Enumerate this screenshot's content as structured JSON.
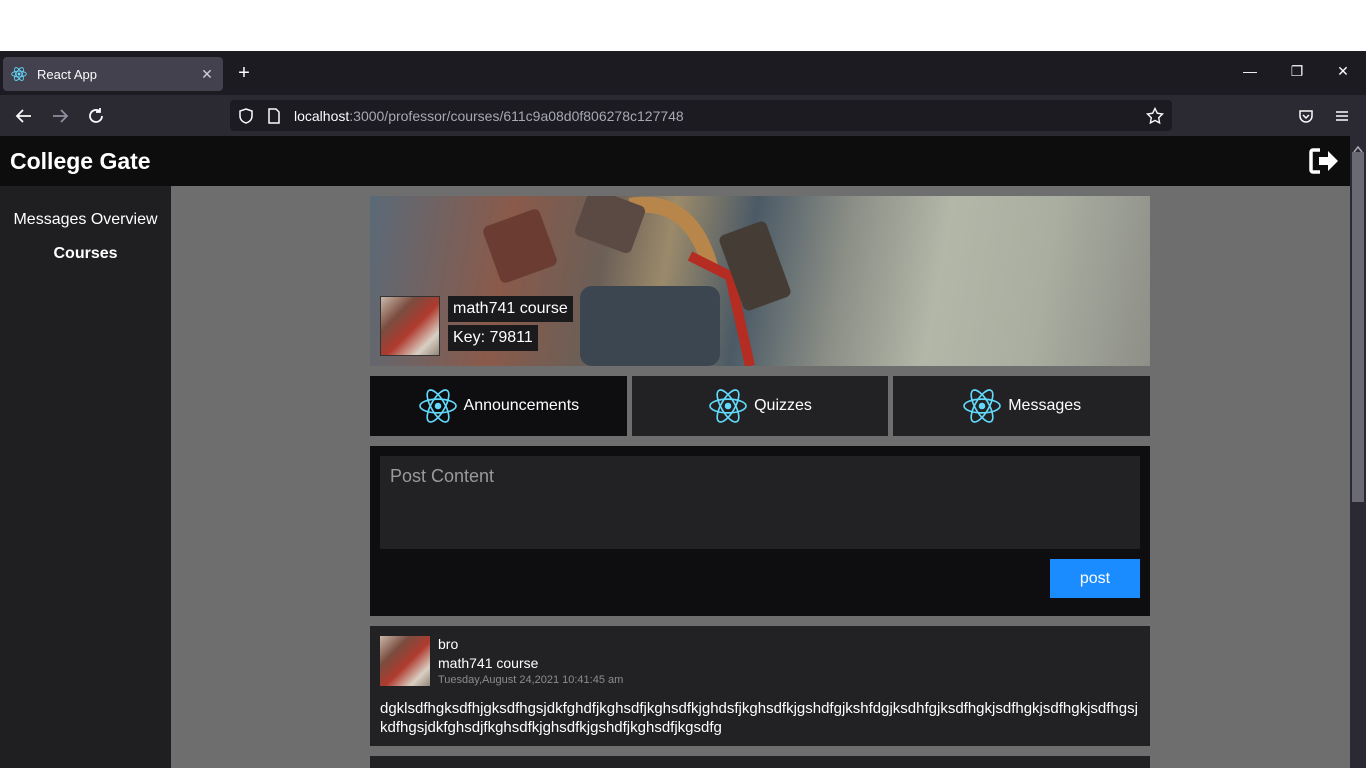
{
  "browser": {
    "tab_title": "React App",
    "url_host": "localhost",
    "url_path": ":3000/professor/courses/611c9a08d0f806278c127748"
  },
  "app": {
    "title": "College Gate"
  },
  "sidebar": {
    "items": [
      {
        "label": "Messages Overview",
        "active": false
      },
      {
        "label": "Courses",
        "active": true
      }
    ]
  },
  "course": {
    "name": "math741 course",
    "key": "Key: 79811"
  },
  "tabs": [
    {
      "label": "Announcements",
      "active": true
    },
    {
      "label": "Quizzes",
      "active": false
    },
    {
      "label": "Messages",
      "active": false
    }
  ],
  "composer": {
    "placeholder": "Post Content",
    "button_label": "post"
  },
  "posts": [
    {
      "author": "bro",
      "course": "math741 course",
      "date": "Tuesday,August 24,2021 10:41:45 am",
      "body": "dgklsdfhgksdfhjgksdfhgsjdkfghdfjkghsdfjkghsdfkjghdsfjkghsdfkjgshdfgjkshfdgjksdhfgjksdfhgkjsdfhgkjsdfhgkjsdfhgsjkdfhgsjdkfghsdjfkghsdfkjghsdfkjgshdfjkghsdfjkgsdfg"
    }
  ],
  "colors": {
    "accent": "#1a8cff",
    "react_icon": "#61dafb",
    "header_bg": "#0d0d0d",
    "sidebar_bg": "#1f1f22",
    "content_bg": "#6e6e6e"
  }
}
